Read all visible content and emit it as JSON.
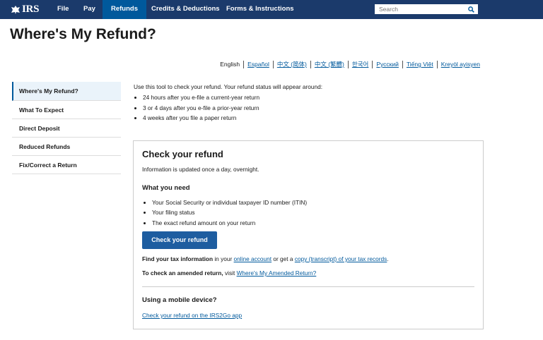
{
  "nav": {
    "logo": "IRS",
    "items": [
      {
        "label": "File",
        "active": false
      },
      {
        "label": "Pay",
        "active": false
      },
      {
        "label": "Refunds",
        "active": true
      },
      {
        "label": "Credits & Deductions",
        "active": false
      },
      {
        "label": "Forms & Instructions",
        "active": false
      }
    ],
    "search_placeholder": "Search"
  },
  "page_title": "Where's My Refund?",
  "languages": [
    "English",
    "Español",
    "中文 (简体)",
    "中文 (繁體)",
    "한국어",
    "Русский",
    "Tiếng Việt",
    "Kreyòl ayisyen"
  ],
  "sidebar": {
    "items": [
      {
        "label": "Where's My Refund?",
        "active": true
      },
      {
        "label": "What To Expect"
      },
      {
        "label": "Direct Deposit"
      },
      {
        "label": "Reduced Refunds"
      },
      {
        "label": "Fix/Correct a Return"
      }
    ]
  },
  "intro": "Use this tool to check your refund. Your refund status will appear around:",
  "timeframes": [
    "24 hours after you e-file a current-year return",
    "3 or 4 days after you e-file a prior-year return",
    "4 weeks after you file a paper return"
  ],
  "card": {
    "title": "Check your refund",
    "updated": "Information is updated once a day, overnight.",
    "need_title": "What you need",
    "need_items": [
      "Your Social Security or individual taxpayer ID number (ITIN)",
      "Your filing status",
      "The exact refund amount on your return"
    ],
    "button": "Check your refund",
    "tax_info": {
      "bold": "Find your tax information",
      "text1": " in your ",
      "link1": "online account",
      "text2": " or get a ",
      "link2": "copy (transcript) of your tax records",
      "text3": "."
    },
    "amended": {
      "bold": "To check an amended return,",
      "text": " visit ",
      "link": "Where's My Amended Return?"
    },
    "mobile_title": "Using a mobile device?",
    "mobile_link": "Check your refund on the IRS2Go app"
  }
}
